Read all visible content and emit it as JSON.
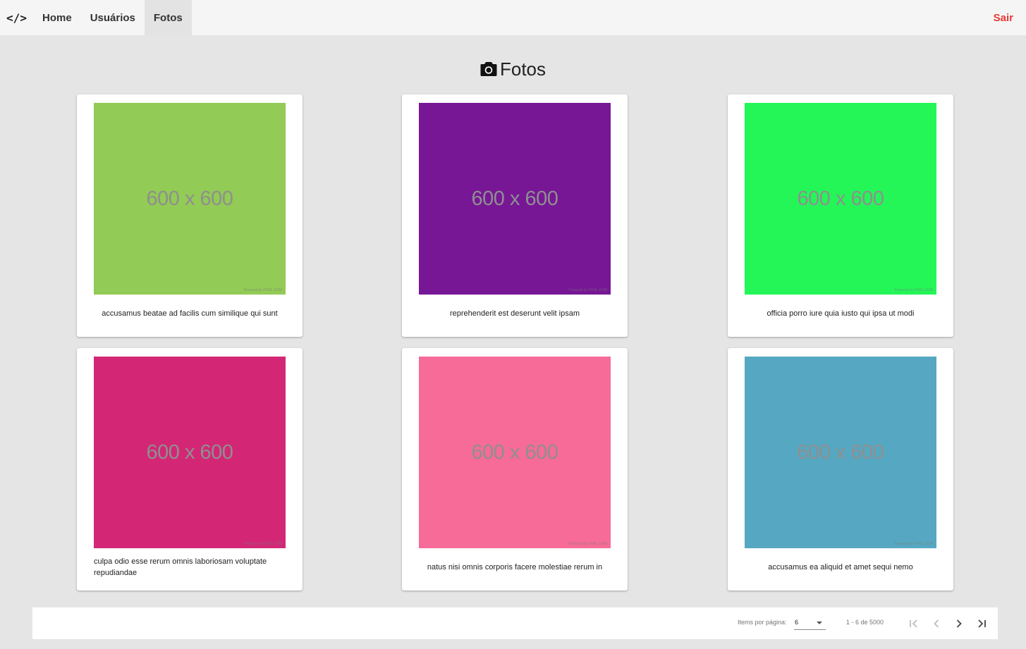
{
  "nav": {
    "brand": "</>",
    "links": [
      {
        "label": "Home"
      },
      {
        "label": "Usuários"
      },
      {
        "label": "Fotos"
      }
    ],
    "active_link": "Fotos",
    "logout_label": "Sair",
    "logout_color": "#e53935"
  },
  "page": {
    "title": "Fotos",
    "title_icon": "camera-icon"
  },
  "photos": [
    {
      "color": "#92cb55",
      "placeholder_text": "600 x 600",
      "watermark": "Powered by HTML.COM",
      "title": "accusamus beatae ad facilis cum similique qui sunt"
    },
    {
      "color": "#771796",
      "placeholder_text": "600 x 600",
      "watermark": "Powered by HTML.COM",
      "title": "reprehenderit est deserunt velit ipsam"
    },
    {
      "color": "#24f658",
      "placeholder_text": "600 x 600",
      "watermark": "Powered by HTML.COM",
      "title": "officia porro iure quia iusto qui ipsa ut modi"
    },
    {
      "color": "#d32776",
      "placeholder_text": "600 x 600",
      "watermark": "Powered by HTML.COM",
      "title": "culpa odio esse rerum omnis laboriosam voluptate repudiandae"
    },
    {
      "color": "#f66b97",
      "placeholder_text": "600 x 600",
      "watermark": "Powered by HTML.COM",
      "title": "natus nisi omnis corporis facere molestiae rerum in"
    },
    {
      "color": "#56a8c2",
      "placeholder_text": "600 x 600",
      "watermark": "Powered by HTML.COM",
      "title": "accusamus ea aliquid et amet sequi nemo"
    }
  ],
  "paginator": {
    "items_per_page_label": "Items por página:",
    "items_per_page_value": "6",
    "range_label": "1 - 6 de 5000",
    "buttons": [
      "first-page-icon",
      "previous-page-icon",
      "next-page-icon",
      "last-page-icon"
    ]
  }
}
